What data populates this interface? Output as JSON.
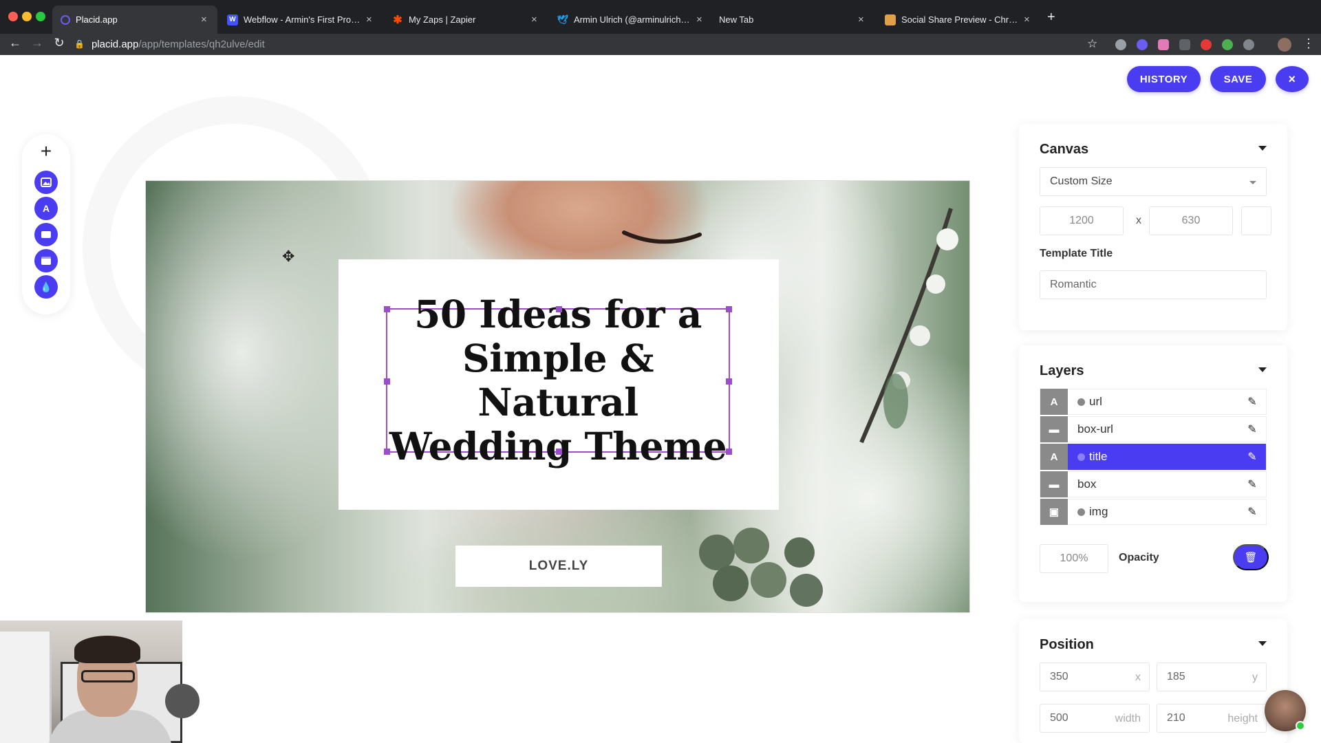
{
  "browser": {
    "tabs": [
      {
        "title": "Placid.app",
        "active": true,
        "favicon": "placid-icon",
        "fav_color": "#6b5cf6"
      },
      {
        "title": "Webflow - Armin's First Project",
        "favicon": "webflow-icon",
        "fav_color": "#4353ff"
      },
      {
        "title": "My Zaps | Zapier",
        "favicon": "zapier-icon",
        "fav_color": "#ff4a00"
      },
      {
        "title": "Armin Ulrich (@arminulrich) / Tw",
        "favicon": "twitter-icon",
        "fav_color": "#1da1f2"
      },
      {
        "title": "New Tab",
        "favicon": "none",
        "fav_color": "#202124"
      },
      {
        "title": "Social Share Preview - Chrome V",
        "favicon": "chrome-store-icon",
        "fav_color": "#e0a04a"
      }
    ],
    "url_host": "placid.app",
    "url_path": "/app/templates/qh2ulve/edit"
  },
  "header": {
    "history_label": "HISTORY",
    "save_label": "SAVE",
    "close_label": "×"
  },
  "canvas_content": {
    "title_lines": [
      "50 Ideas for a",
      "Simple & Natural",
      "Wedding Theme"
    ],
    "url_text": "LOVE.LY"
  },
  "panel_canvas": {
    "heading": "Canvas",
    "size_option": "Custom Size",
    "width": "1200",
    "x_sep": "x",
    "height": "630",
    "template_title_label": "Template Title",
    "template_title_value": "Romantic"
  },
  "panel_layers": {
    "heading": "Layers",
    "layers": [
      {
        "name": "url",
        "icon": "A",
        "has_dot": true,
        "active": false
      },
      {
        "name": "box-url",
        "icon": "▬",
        "has_dot": false,
        "active": false
      },
      {
        "name": "title",
        "icon": "A",
        "has_dot": true,
        "active": true
      },
      {
        "name": "box",
        "icon": "▬",
        "has_dot": false,
        "active": false
      },
      {
        "name": "img",
        "icon": "▣",
        "has_dot": true,
        "active": false
      }
    ],
    "opacity_value": "100%",
    "opacity_label": "Opacity"
  },
  "panel_position": {
    "heading": "Position",
    "x_value": "350",
    "x_suffix": "x",
    "y_value": "185",
    "y_suffix": "y",
    "width_value": "500",
    "width_suffix": "width",
    "height_value": "210",
    "height_suffix": "height"
  },
  "colors": {
    "accent": "#4a3cf0",
    "selection": "#9b4dca"
  }
}
